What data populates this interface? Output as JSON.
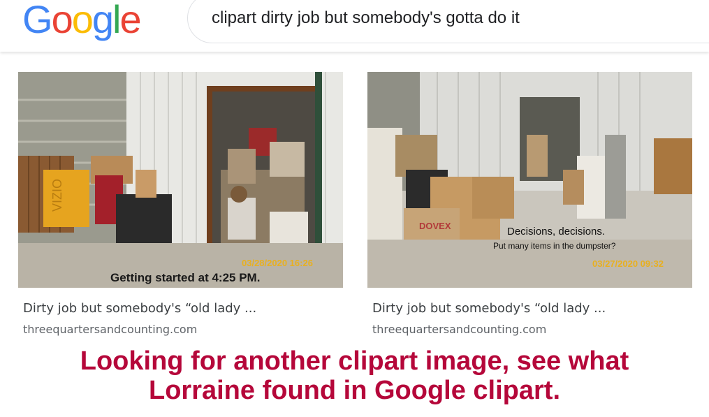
{
  "logo": {
    "letters": [
      "G",
      "o",
      "o",
      "g",
      "l",
      "e"
    ],
    "colors": [
      "#4285F4",
      "#EA4335",
      "#FBBC05",
      "#4285F4",
      "#34A853",
      "#EA4335"
    ]
  },
  "search": {
    "query": "clipart dirty job but somebody's gotta do it"
  },
  "results": [
    {
      "title": "Dirty job but somebody's “old lady ...",
      "source": "threequartersandcounting.com",
      "photo_caption": "Getting started at 4:25 PM.",
      "photo_stamp": "03/28/2020 16:26"
    },
    {
      "title": "Dirty job but somebody's “old lady ...",
      "source": "threequartersandcounting.com",
      "photo_caption_line1": "Decisions, decisions.",
      "photo_caption_line2": "Put many items in the dumpster?",
      "photo_stamp": "03/27/2020 09:32"
    }
  ],
  "overlay_caption": {
    "line1": "Looking for another clipart image, see what",
    "line2": "Lorraine found in Google clipart."
  },
  "colors": {
    "caption": "#b5073a",
    "title": "#3c4043",
    "source": "#5f6368"
  }
}
